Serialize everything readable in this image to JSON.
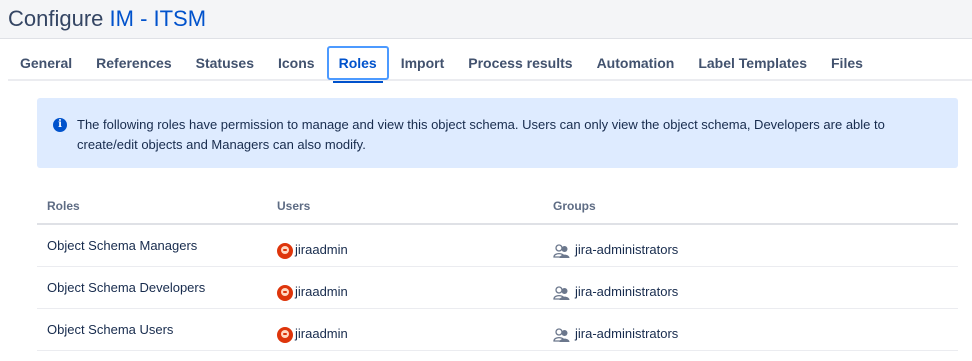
{
  "header": {
    "prefix": "Configure ",
    "schema_name": "IM - ITSM"
  },
  "tabs": [
    {
      "label": "General"
    },
    {
      "label": "References"
    },
    {
      "label": "Statuses"
    },
    {
      "label": "Icons"
    },
    {
      "label": "Roles",
      "active": true
    },
    {
      "label": "Import"
    },
    {
      "label": "Process results"
    },
    {
      "label": "Automation"
    },
    {
      "label": "Label Templates"
    },
    {
      "label": "Files"
    }
  ],
  "info_icon": "info-icon",
  "info_text": "The following roles have permission to manage and view this object schema. Users can only view the object schema, Developers are able to create/edit objects and Managers can also modify.",
  "table": {
    "headers": {
      "roles": "Roles",
      "users": "Users",
      "groups": "Groups"
    },
    "rows": [
      {
        "role": "Object Schema Managers",
        "user": "jiraadmin",
        "group": "jira-administrators"
      },
      {
        "role": "Object Schema Developers",
        "user": "jiraadmin",
        "group": "jira-administrators"
      },
      {
        "role": "Object Schema Users",
        "user": "jiraadmin",
        "group": "jira-administrators"
      }
    ]
  },
  "colors": {
    "accent": "#0052cc",
    "info_bg": "#deebff",
    "avatar": "#de350b"
  }
}
